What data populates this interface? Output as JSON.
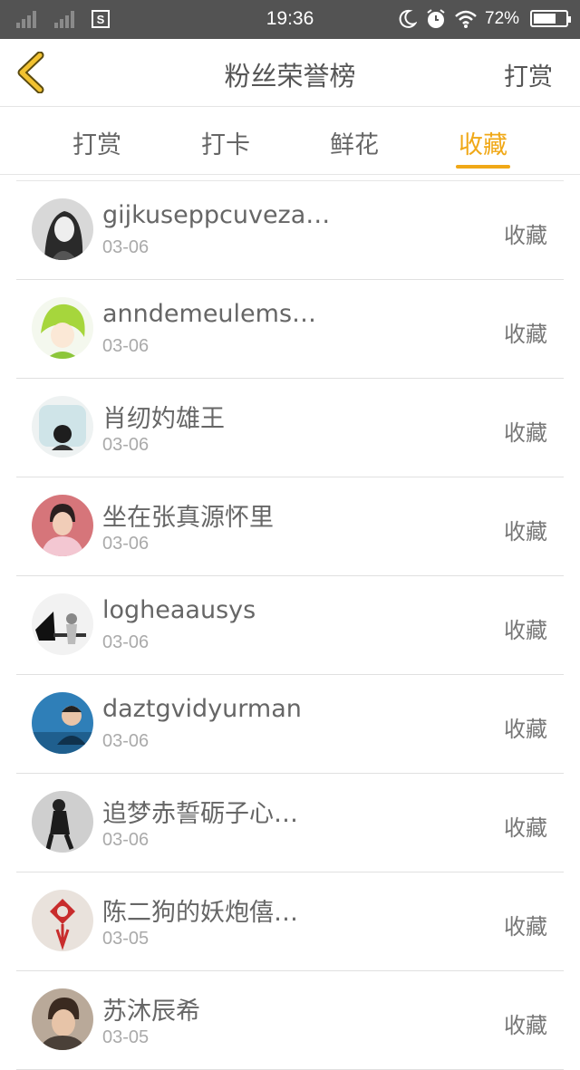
{
  "status_bar": {
    "time": "19:36",
    "battery_percent": "72%",
    "battery_level": 0.72
  },
  "header": {
    "title": "粉丝荣誉榜",
    "right_action": "打赏"
  },
  "tabs": [
    {
      "label": "打赏",
      "active": false
    },
    {
      "label": "打卡",
      "active": false
    },
    {
      "label": "鲜花",
      "active": false
    },
    {
      "label": "收藏",
      "active": true
    }
  ],
  "accent_color": "#f0a817",
  "list": [
    {
      "name": "gijkuseppcuveza…",
      "date": "03-06",
      "action": "收藏"
    },
    {
      "name": "anndemeulems…",
      "date": "03-06",
      "action": "收藏"
    },
    {
      "name": "肖纫妁雄王",
      "date": "03-06",
      "action": "收藏"
    },
    {
      "name": "坐在张真源怀里",
      "date": "03-06",
      "action": "收藏"
    },
    {
      "name": "logheaausys",
      "date": "03-06",
      "action": "收藏"
    },
    {
      "name": "daztgvidyurman",
      "date": "03-06",
      "action": "收藏"
    },
    {
      "name": "追梦赤誓砺子心…",
      "date": "03-06",
      "action": "收藏"
    },
    {
      "name": "陈二狗的妖炮僖…",
      "date": "03-05",
      "action": "收藏"
    },
    {
      "name": "苏沐辰希",
      "date": "03-05",
      "action": "收藏"
    }
  ]
}
